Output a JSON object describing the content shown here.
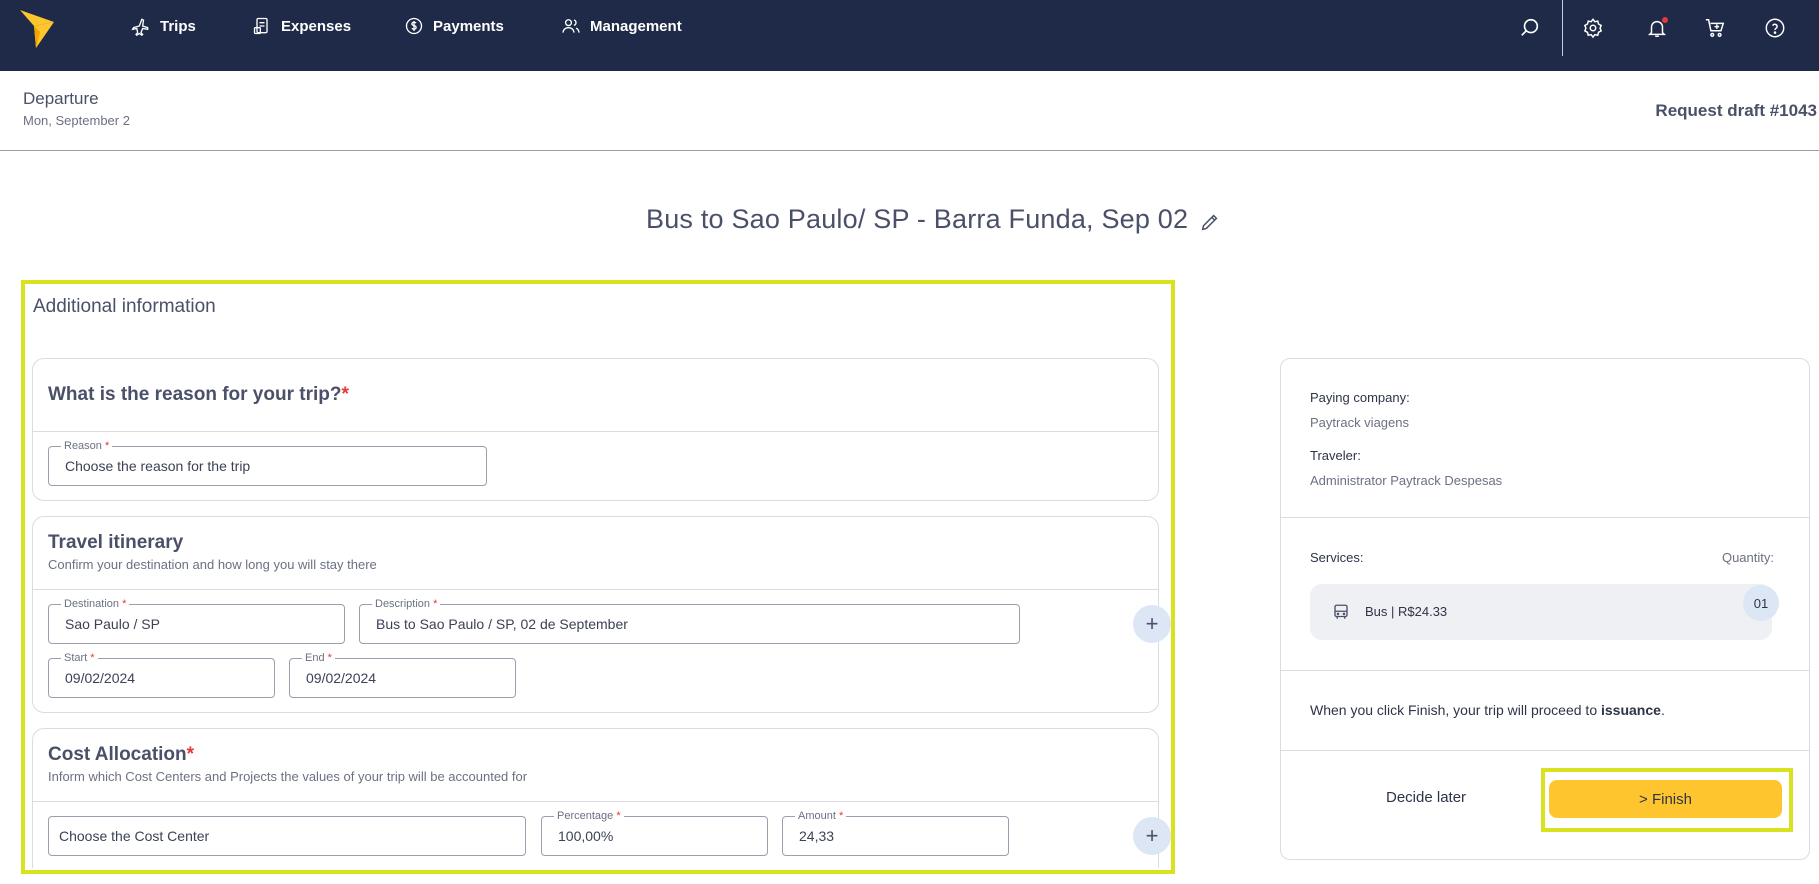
{
  "nav": {
    "items": [
      {
        "label": "Trips",
        "icon": "plane-icon"
      },
      {
        "label": "Expenses",
        "icon": "receipt-icon"
      },
      {
        "label": "Payments",
        "icon": "dollar-coin-icon"
      },
      {
        "label": "Management",
        "icon": "users-icon"
      }
    ],
    "right_icons": [
      "search-icon",
      "gear-icon",
      "bell-icon",
      "cart-icon",
      "help-icon"
    ]
  },
  "header": {
    "departure_label": "Departure",
    "departure_date": "Mon, September 2",
    "draft_label": "Request draft #1043"
  },
  "trip_title": "Bus to Sao Paulo/ SP - Barra Funda, Sep 02",
  "additional_info": {
    "title": "Additional information",
    "reason": {
      "heading": "What is the reason for your trip?",
      "field_label": "Reason",
      "placeholder": "Choose the reason for the trip"
    },
    "itinerary": {
      "heading": "Travel itinerary",
      "subtitle": "Confirm your destination and how long you will stay there",
      "destination_label": "Destination",
      "destination_value": "Sao Paulo / SP",
      "description_label": "Description",
      "description_value": "Bus to Sao Paulo / SP, 02 de September",
      "start_label": "Start",
      "start_value": "09/02/2024",
      "end_label": "End",
      "end_value": "09/02/2024"
    },
    "cost_allocation": {
      "heading": "Cost Allocation",
      "subtitle": "Inform which Cost Centers and Projects the values of your trip will be accounted for",
      "cost_center_placeholder": "Choose the Cost Center",
      "percentage_label": "Percentage",
      "percentage_value": "100,00%",
      "amount_label": "Amount",
      "amount_value": "24,33"
    }
  },
  "summary": {
    "paying_company_label": "Paying company:",
    "paying_company_value": "Paytrack viagens",
    "traveler_label": "Traveler:",
    "traveler_value": "Administrator Paytrack Despesas",
    "services_label": "Services:",
    "quantity_label": "Quantity:",
    "service_text": "Bus  |  R$24.33",
    "service_qty": "01",
    "finish_note_prefix": "When you click Finish, your trip will proceed to ",
    "finish_note_bold": "issuance",
    "finish_note_suffix": ".",
    "decide_later": "Decide later",
    "finish_button": "> Finish"
  },
  "colors": {
    "nav_bg": "#1e2a47",
    "accent_yellow": "#fec52e",
    "highlight": "#d9e21f",
    "required": "#e53935"
  }
}
